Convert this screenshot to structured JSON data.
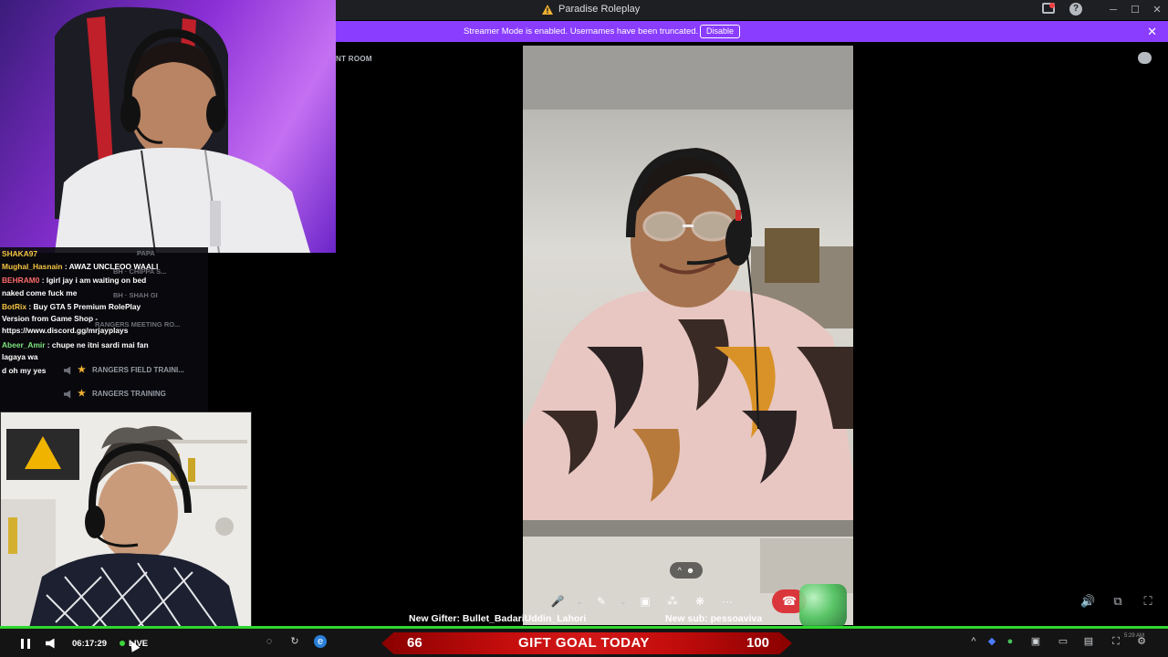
{
  "window": {
    "title": "Paradise Roleplay",
    "help_icon": "?",
    "minimize_icon": "─",
    "maximize_icon": "☐",
    "close_icon": "✕"
  },
  "banner": {
    "message": "Streamer Mode is enabled. Usernames have been truncated.",
    "disable_label": "Disable",
    "close_icon": "✕"
  },
  "room": {
    "name": "NT ROOM"
  },
  "chat": {
    "messages": [
      {
        "user": "SHAKA97",
        "text": "",
        "color": "#f5c542"
      },
      {
        "user": "Mughal_Hasnain",
        "text": " : AWAZ UNCLEOO WAALI",
        "color": "#f5c542"
      },
      {
        "user": "BEHRAM0",
        "text": " : Igirl jay i am waiting on bed",
        "color": "#ff6b6b"
      },
      {
        "user": "",
        "text": "naked come fuck me",
        "color": "#ffffff"
      },
      {
        "user": "BotRix",
        "text": " : Buy GTA 5 Premium RolePlay",
        "color": "#f5c542"
      },
      {
        "user": "",
        "text": "Version from Game Shop -",
        "color": "#ffffff"
      },
      {
        "user": "",
        "text": "https://www.discord.gg/mrjayplays",
        "color": "#ffffff"
      },
      {
        "user": "Abeer_Amir",
        "text": " : chupe ne itni sardi mai fan",
        "color": "#7ee57e"
      },
      {
        "user": "",
        "text": "lagaya wa",
        "color": "#ffffff"
      },
      {
        "user": "",
        "text": "d oh my yes",
        "color": "#ffffff"
      }
    ],
    "ghosts": {
      "papa": "PAPA",
      "bh_chippa": "BH · CHIPPA S...",
      "bh_shah": "BH · SHAH GI",
      "meeting": "RANGERS MEETING RO..."
    },
    "channels": {
      "field_training": "RANGERS FIELD TRAINI...",
      "training": "RANGERS TRAINING"
    }
  },
  "call": {
    "expand_icon": "^",
    "controls": {
      "mic": "🎤",
      "mic_menu": "⌄",
      "camera": "✎",
      "camera_menu": "⌄",
      "screenshare": "▣",
      "activities": "⁂",
      "soundboard": "❋",
      "more": "···",
      "hangup": "☎"
    },
    "volume_icon": "🔊",
    "popout_icon": "⧉",
    "fullscreen_icon": "⛶"
  },
  "stream": {
    "new_gifter": "New Gifter: Bullet_BadariUddin_Lahori",
    "new_sub": "New sub: pessoaviva",
    "goal_current": "66",
    "goal_label": "GIFT GOAL TODAY",
    "goal_target": "100",
    "time": "06:17:29",
    "live_label": "LIVE",
    "clock": "5:29 AM"
  },
  "tray": {
    "up_arrow": "^",
    "settings": "⚙"
  }
}
